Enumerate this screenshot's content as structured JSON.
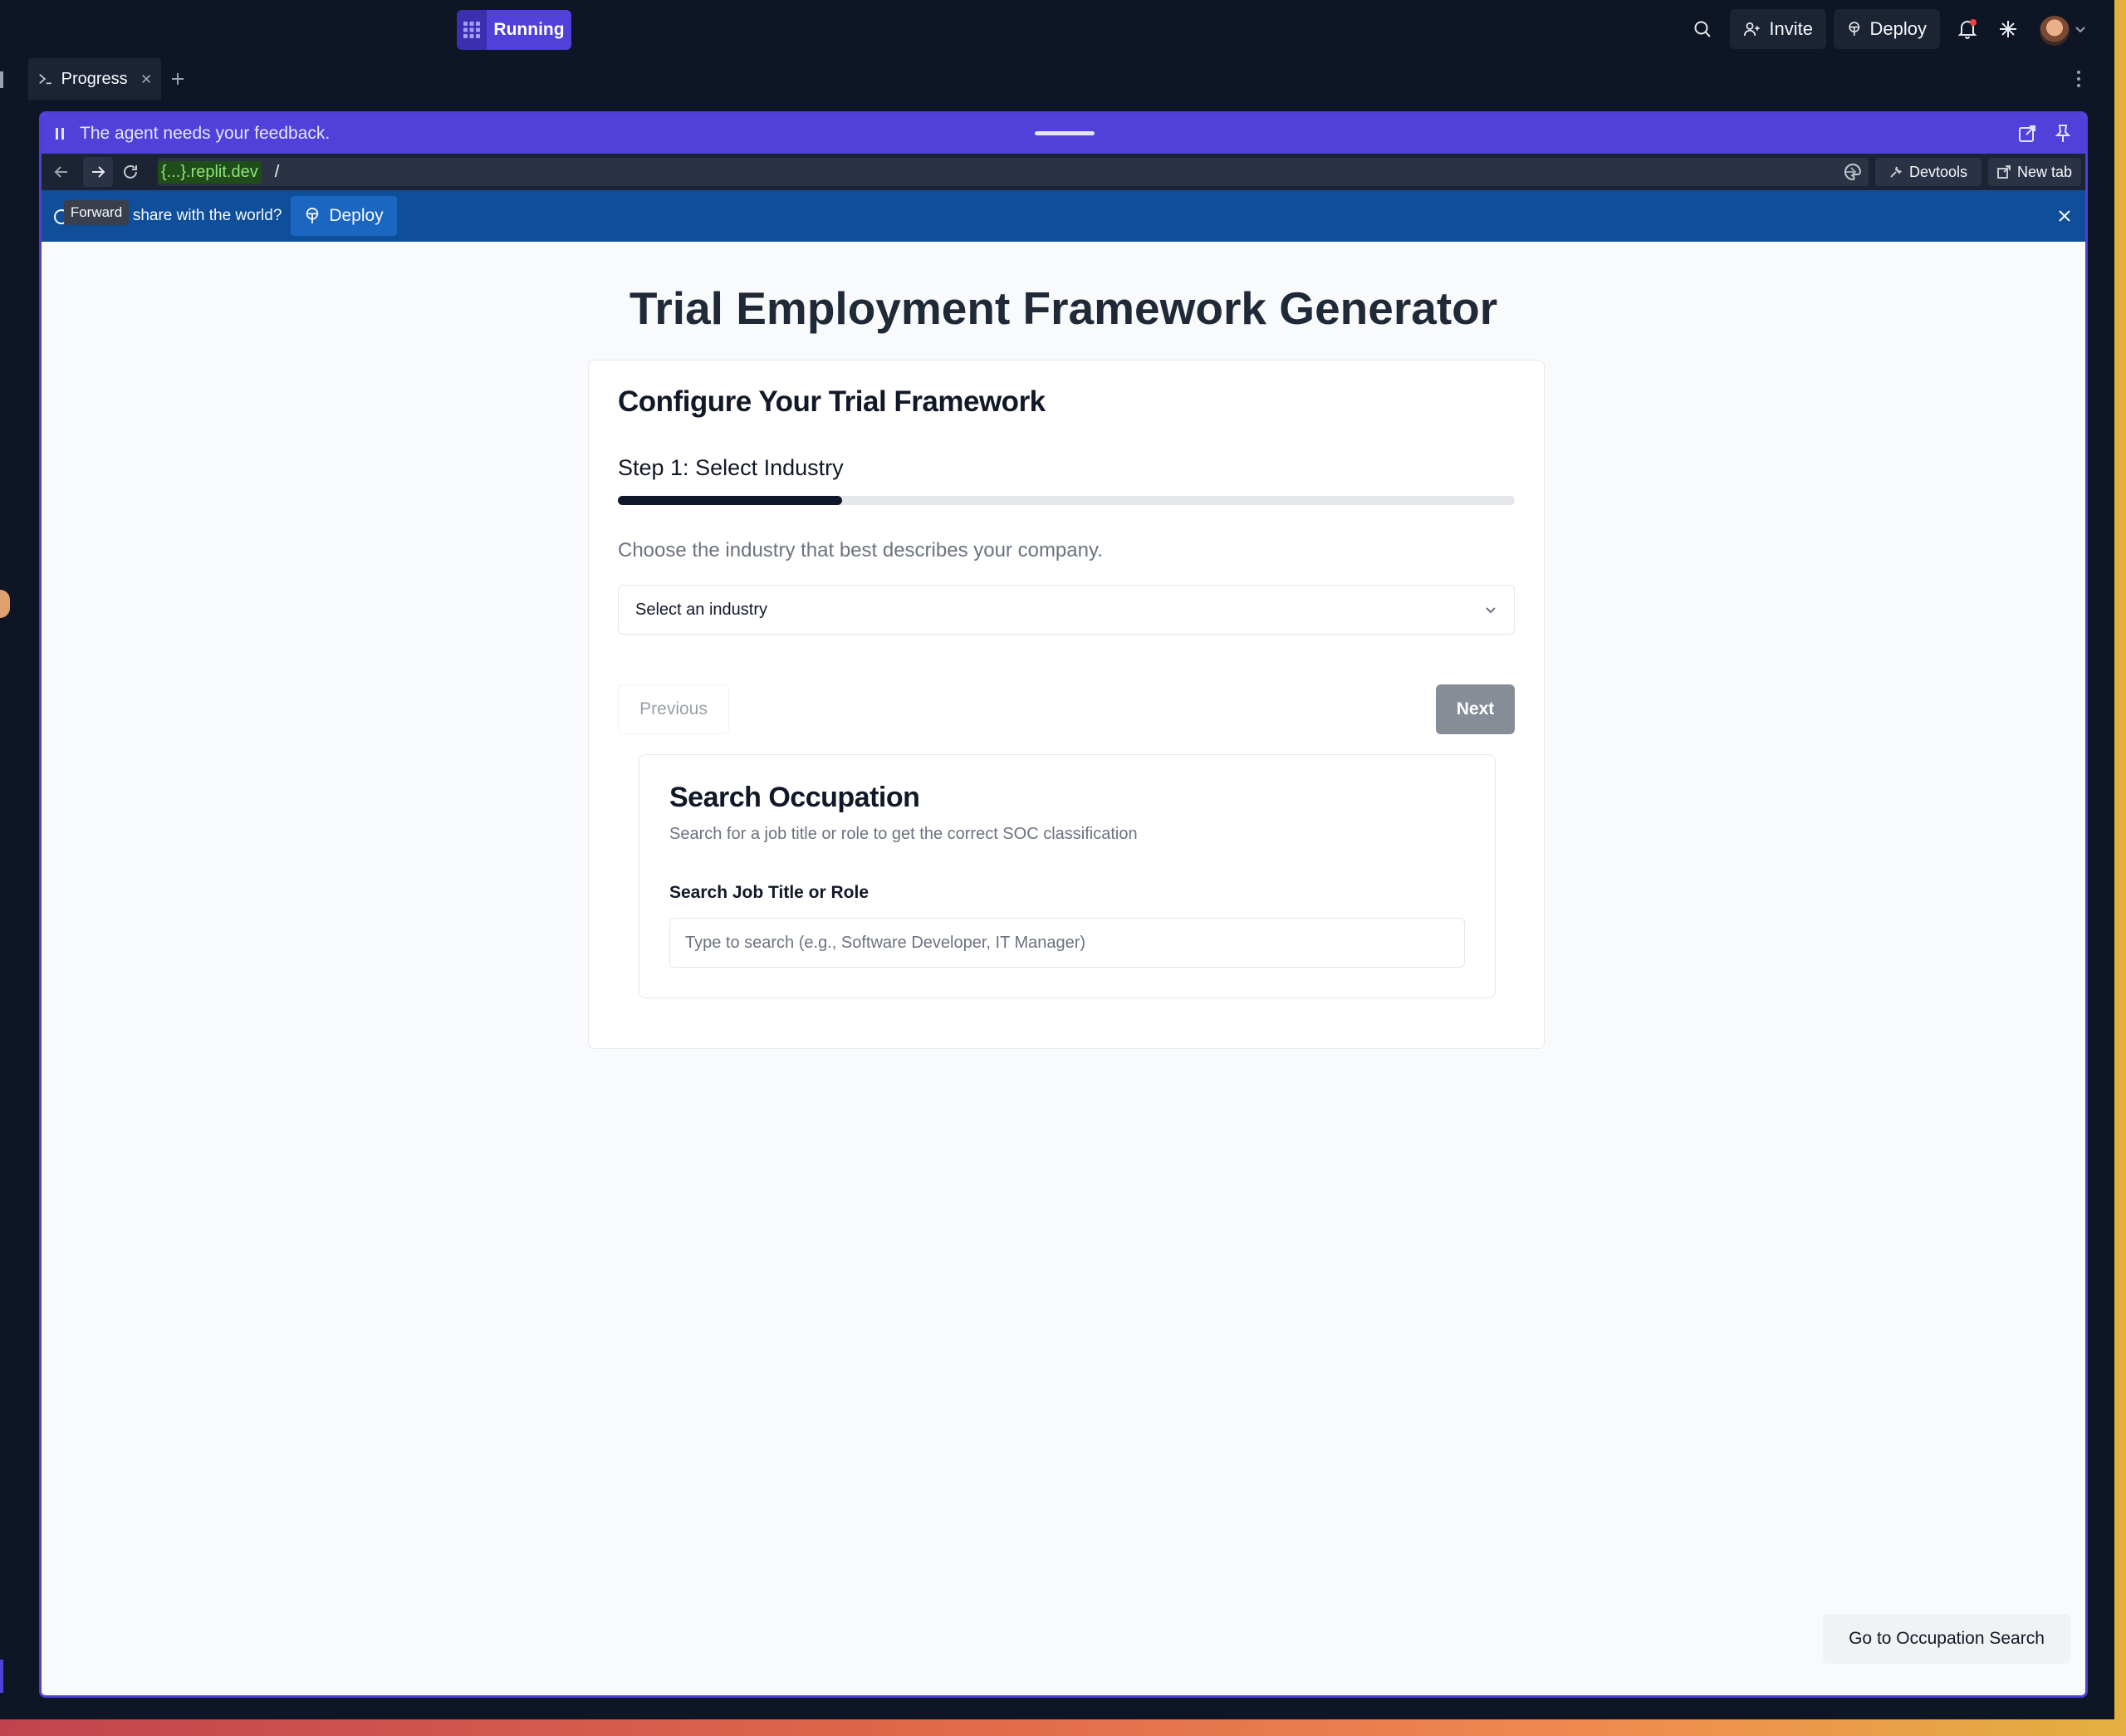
{
  "topbar": {
    "run_label": "Running",
    "invite_label": "Invite",
    "deploy_label": "Deploy"
  },
  "tabs": {
    "active_label": "Progress"
  },
  "preview": {
    "feedback_text": "The agent needs your feedback.",
    "url_domain": "{...}.replit.dev",
    "url_path": "/",
    "devtools_label": "Devtools",
    "newtab_label": "New tab",
    "tooltip": "Forward",
    "banner_text": "o share with the world?",
    "banner_deploy_label": "Deploy"
  },
  "page": {
    "title": "Trial Employment Framework Generator",
    "card_title": "Configure Your Trial Framework",
    "step_title": "Step 1: Select Industry",
    "progress_fraction": 0.25,
    "step_description": "Choose the industry that best describes your company.",
    "industry_select_value": "Select an industry",
    "previous_label": "Previous",
    "next_label": "Next",
    "occupation": {
      "title": "Search Occupation",
      "subtitle": "Search for a job title or role to get the correct SOC classification",
      "field_label": "Search Job Title or Role",
      "placeholder": "Type to search (e.g., Software Developer, IT Manager)"
    },
    "go_button_label": "Go to Occupation Search"
  },
  "colors": {
    "accent": "#5140d9",
    "banner": "#0f4f99",
    "progress": "#0f172a"
  }
}
